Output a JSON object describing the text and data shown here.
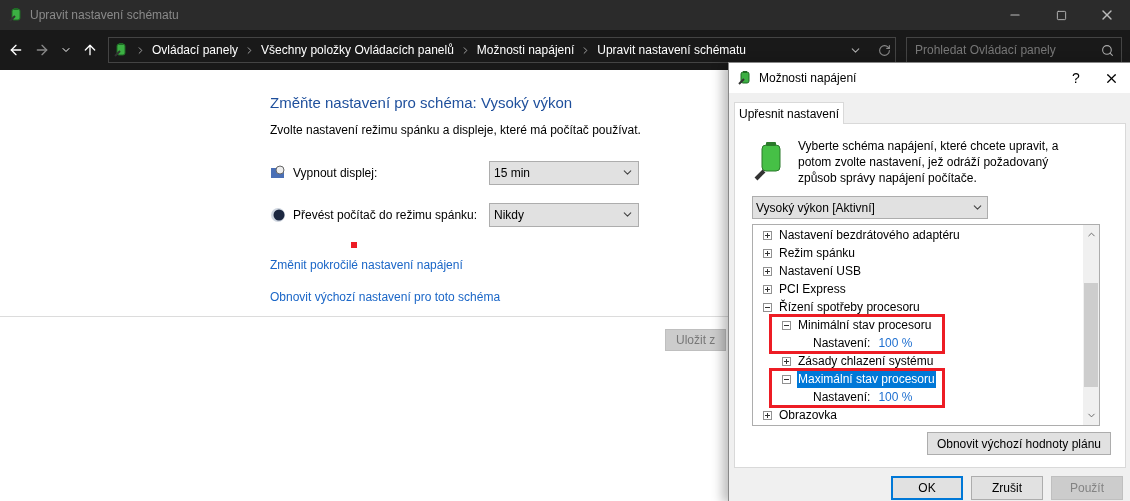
{
  "window": {
    "title": "Upravit nastavení schématu"
  },
  "address_bar": {
    "breadcrumbs": [
      "Ovládací panely",
      "Všechny položky Ovládacích panelů",
      "Možnosti napájení",
      "Upravit nastavení schématu"
    ],
    "search": {
      "placeholder": "Prohledat Ovládací panely"
    }
  },
  "content": {
    "heading": "Změňte nastavení pro schéma: Vysoký výkon",
    "subtitle": "Zvolte nastavení režimu spánku a displeje, které má počítač používat.",
    "settings": [
      {
        "kind": "display",
        "label": "Vypnout displej:",
        "value": "15 min"
      },
      {
        "kind": "sleep",
        "label": "Převést počítač do režimu spánku:",
        "value": "Nikdy"
      }
    ],
    "links": [
      "Změnit pokročilé nastavení napájení",
      "Obnovit výchozí nastavení pro toto schéma"
    ],
    "save_button": {
      "label": "Uložit z",
      "disabled": true
    }
  },
  "dialog": {
    "title": "Možnosti napájení",
    "help": "?",
    "tabs": [
      {
        "label": "Upřesnit nastavení",
        "selected": true
      }
    ],
    "description": "Vyberte schéma napájení, které chcete upravit, a potom zvolte nastavení, jež odráží požadovaný způsob správy napájení počítače.",
    "scheme": "Vysoký výkon [Aktivní]",
    "tree": [
      {
        "kind": "group",
        "label": "Nastavení bezdrátového adaptéru",
        "expanded": false,
        "selected": false,
        "highlighted": false
      },
      {
        "kind": "group",
        "label": "Režim spánku",
        "expanded": false,
        "selected": false,
        "highlighted": false
      },
      {
        "kind": "group",
        "label": "Nastavení USB",
        "expanded": false,
        "selected": false,
        "highlighted": false
      },
      {
        "kind": "group",
        "label": "PCI Express",
        "expanded": false,
        "selected": false,
        "highlighted": false
      },
      {
        "kind": "group",
        "label": "Řízení spotřeby procesoru",
        "expanded": true,
        "selected": false,
        "highlighted": false,
        "children": [
          {
            "kind": "group",
            "label": "Minimální stav procesoru",
            "expanded": true,
            "selected": false,
            "highlighted": true,
            "children": [
              {
                "kind": "setting",
                "label": "Nastavení:",
                "value": "100 %"
              }
            ]
          },
          {
            "kind": "group",
            "label": "Zásady chlazení systému",
            "expanded": false,
            "selected": false,
            "highlighted": false
          },
          {
            "kind": "group",
            "label": "Maximální stav procesoru",
            "expanded": true,
            "selected": true,
            "highlighted": true,
            "children": [
              {
                "kind": "setting",
                "label": "Nastavení:",
                "value": "100 %"
              }
            ]
          }
        ]
      },
      {
        "kind": "group",
        "label": "Obrazovka",
        "expanded": false,
        "selected": false,
        "highlighted": false
      }
    ],
    "reset_button": "Obnovit výchozí hodnoty plánu",
    "buttons": [
      {
        "label": "OK",
        "kind": "default",
        "disabled": false
      },
      {
        "label": "Zrušit",
        "kind": "normal",
        "disabled": false
      },
      {
        "label": "Použít",
        "kind": "normal",
        "disabled": true
      }
    ]
  }
}
